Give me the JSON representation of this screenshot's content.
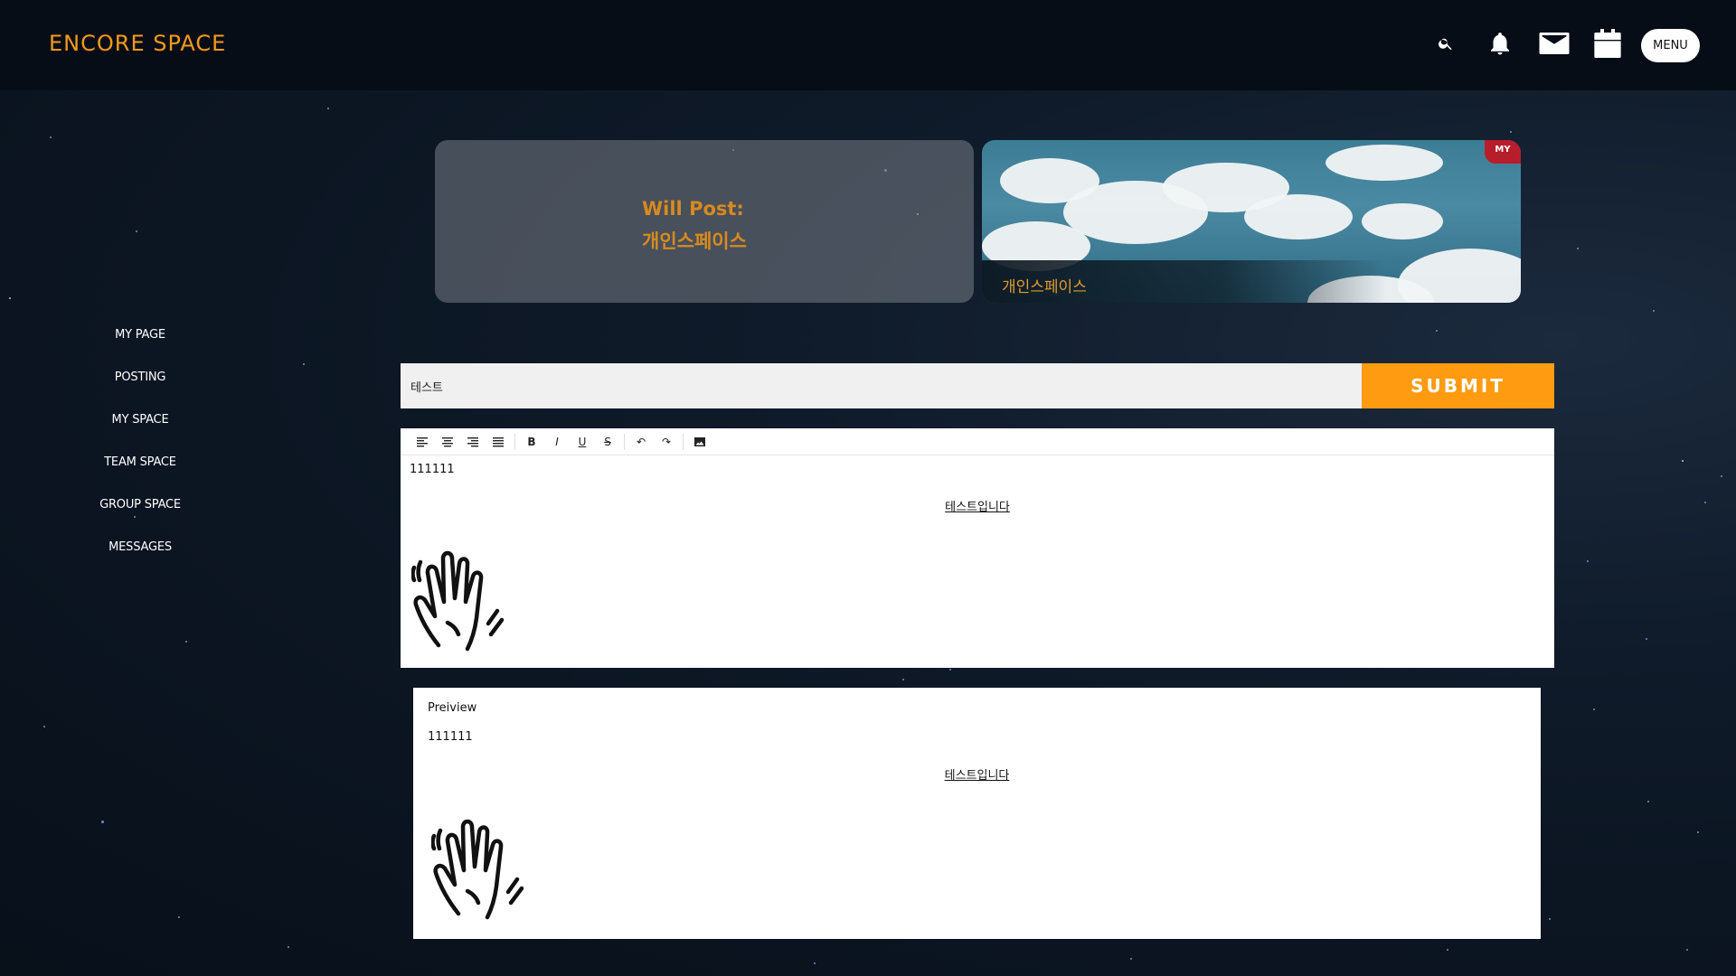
{
  "header": {
    "brand": "ENCORE SPACE",
    "menu_label": "MENU",
    "icons": [
      "search-icon",
      "bell-icon",
      "mail-icon",
      "calendar-icon"
    ]
  },
  "sidebar": {
    "items": [
      {
        "label": "MY PAGE"
      },
      {
        "label": "POSTING"
      },
      {
        "label": "MY SPACE"
      },
      {
        "label": "TEAM SPACE"
      },
      {
        "label": "GROUP SPACE"
      },
      {
        "label": "MESSAGES"
      }
    ]
  },
  "will_post": {
    "line1": "Will Post:",
    "line2": "개인스페이스"
  },
  "space_card": {
    "name": "개인스페이스",
    "badge": "MY"
  },
  "post_form": {
    "title_value": "테스트",
    "submit_label": "SUBMIT"
  },
  "editor": {
    "toolbar": [
      "align-left-icon",
      "align-center-icon",
      "align-right-icon",
      "align-justify-icon",
      "bold-icon",
      "italic-icon",
      "underline-icon",
      "strike-icon",
      "undo-icon",
      "redo-icon",
      "image-icon"
    ],
    "line1": "111111",
    "line2": "테스트입니다"
  },
  "preview": {
    "label": "Preiview",
    "line1": "111111",
    "line2": "테스트입니다"
  },
  "colors": {
    "accent": "#ff9b11",
    "brand": "#f39a1c",
    "badge": "#b71d2b"
  }
}
